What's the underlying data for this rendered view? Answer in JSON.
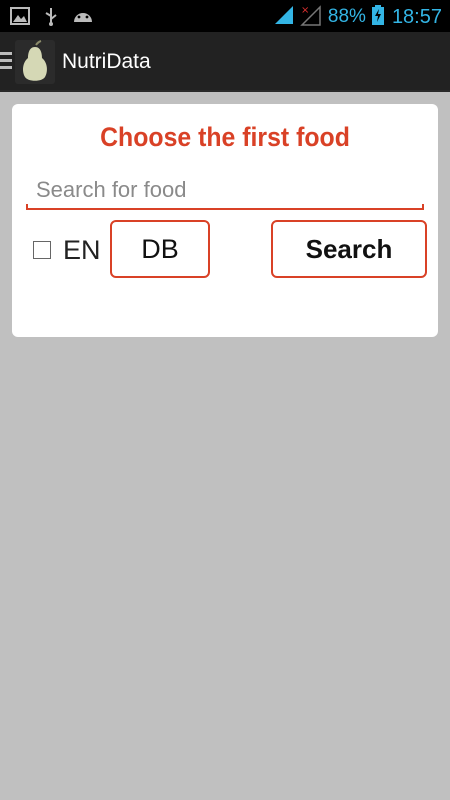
{
  "status_bar": {
    "battery": "88%",
    "time": "18:57",
    "icons": [
      "image-icon",
      "usb-icon",
      "android-icon",
      "wifi-icon",
      "no-signal-icon",
      "battery-charging-icon"
    ]
  },
  "action_bar": {
    "title": "NutriData",
    "logo_icon": "pear-icon"
  },
  "card": {
    "title": "Choose the first food",
    "search_placeholder": "Search for food",
    "search_value": "",
    "en_checkbox_label": "EN",
    "en_checked": false,
    "db_button_label": "DB",
    "search_button_label": "Search"
  },
  "colors": {
    "accent": "#d94126",
    "status_blue": "#33b5e5",
    "action_bar": "#222222",
    "background": "#c0c0c0"
  }
}
